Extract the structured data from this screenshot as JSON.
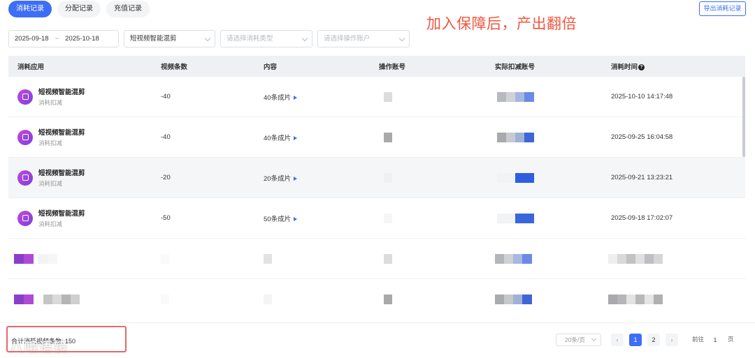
{
  "tabs": [
    {
      "label": "消耗记录",
      "active": true
    },
    {
      "label": "分配记录",
      "active": false
    },
    {
      "label": "充值记录",
      "active": false
    }
  ],
  "annotation": "加入保障后，产出翻倍",
  "export_button": "导出消耗记录",
  "filters": {
    "date_start": "2025-09-18",
    "date_separator": "~",
    "date_end": "2025-10-18",
    "app_select": "短视频智能混剪",
    "type_placeholder": "请选择消耗类型",
    "account_placeholder": "请选择操作账户"
  },
  "table": {
    "headers": [
      "消耗应用",
      "视频条数",
      "内容",
      "操作账号",
      "实际扣减账号",
      "消耗时间"
    ],
    "rows": [
      {
        "app": "短视频智能混剪",
        "sub": "消耗扣减",
        "count": "-40",
        "content": "40条成片",
        "time": "2025-10-10 14:17:48"
      },
      {
        "app": "短视频智能混剪",
        "sub": "消耗扣减",
        "count": "-40",
        "content": "40条成片",
        "time": "2025-09-25 16:04:58"
      },
      {
        "app": "短视频智能混剪",
        "sub": "消耗扣减",
        "count": "-20",
        "content": "20条成片",
        "time": "2025-09-21 13:23:21"
      },
      {
        "app": "短视频智能混剪",
        "sub": "消耗扣减",
        "count": "-50",
        "content": "50条成片",
        "time": "2025-09-18 17:02:07"
      }
    ]
  },
  "footer": {
    "total": "合计消耗视频条数: 150",
    "watermark": "八哦语镜",
    "page_size": "20条/页",
    "pages": [
      "1",
      "2"
    ],
    "prev": "‹",
    "next": "›",
    "goto_label": "前往",
    "goto_value": "1",
    "page_unit": "页"
  },
  "colors": {
    "accent": "#3d6ef5",
    "annotation": "#f2553e",
    "highlight_box": "#e46868"
  }
}
